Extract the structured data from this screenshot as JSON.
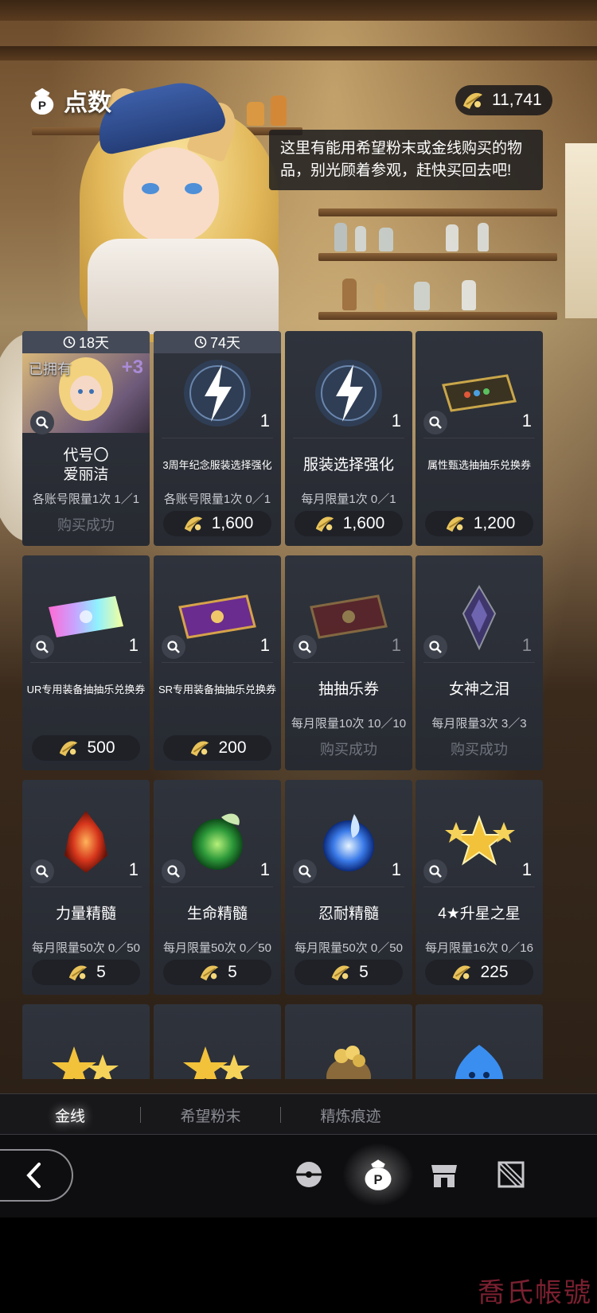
{
  "header": {
    "title": "点数",
    "currency_amount": "11,741",
    "speech": "这里有能用希望粉末或金线购买的物品，别光顾着参观，赶快买回去吧!"
  },
  "items": [
    {
      "timer": "18天",
      "owned_label": "已拥有",
      "plus": "+3",
      "qty": "",
      "name": "代号〇\n爱丽洁",
      "limit": "各账号限量1次 1／1",
      "status": "购买成功",
      "price": ""
    },
    {
      "timer": "74天",
      "qty": "1",
      "name": "3周年纪念服装选择强化",
      "limit": "各账号限量1次 0／1",
      "status": "",
      "price": "1,600"
    },
    {
      "timer": "",
      "qty": "1",
      "name": "服装选择强化",
      "limit": "每月限量1次 0／1",
      "status": "",
      "price": "1,600"
    },
    {
      "timer": "",
      "qty": "1",
      "name": "属性甄选抽抽乐兑换券",
      "limit": "",
      "status": "",
      "price": "1,200"
    },
    {
      "timer": "",
      "qty": "1",
      "name": "UR专用装备抽抽乐兑换券",
      "limit": "",
      "status": "",
      "price": "500"
    },
    {
      "timer": "",
      "qty": "1",
      "name": "SR专用装备抽抽乐兑换券",
      "limit": "",
      "status": "",
      "price": "200"
    },
    {
      "timer": "",
      "qty": "1",
      "name": "抽抽乐券",
      "limit": "每月限量10次 10／10",
      "status": "购买成功",
      "price": ""
    },
    {
      "timer": "",
      "qty": "1",
      "name": "女神之泪",
      "limit": "每月限量3次 3／3",
      "status": "购买成功",
      "price": ""
    },
    {
      "timer": "",
      "qty": "1",
      "name": "力量精髓",
      "limit": "每月限量50次 0／50",
      "status": "",
      "price": "5"
    },
    {
      "timer": "",
      "qty": "1",
      "name": "生命精髓",
      "limit": "每月限量50次 0／50",
      "status": "",
      "price": "5"
    },
    {
      "timer": "",
      "qty": "1",
      "name": "忍耐精髓",
      "limit": "每月限量50次 0／50",
      "status": "",
      "price": "5"
    },
    {
      "timer": "",
      "qty": "1",
      "name": "4★升星之星",
      "limit": "每月限量16次 0／16",
      "status": "",
      "price": "225"
    }
  ],
  "tabs": [
    {
      "label": "金线",
      "active": true
    },
    {
      "label": "希望粉末",
      "active": false
    },
    {
      "label": "精炼痕迹",
      "active": false
    }
  ],
  "watermark": "喬氏帳號",
  "colors": {
    "card_bg": "#2c2f37",
    "price_bg": "#1f2127",
    "muted_text": "#6f737c",
    "gold": "#e8c25a"
  }
}
